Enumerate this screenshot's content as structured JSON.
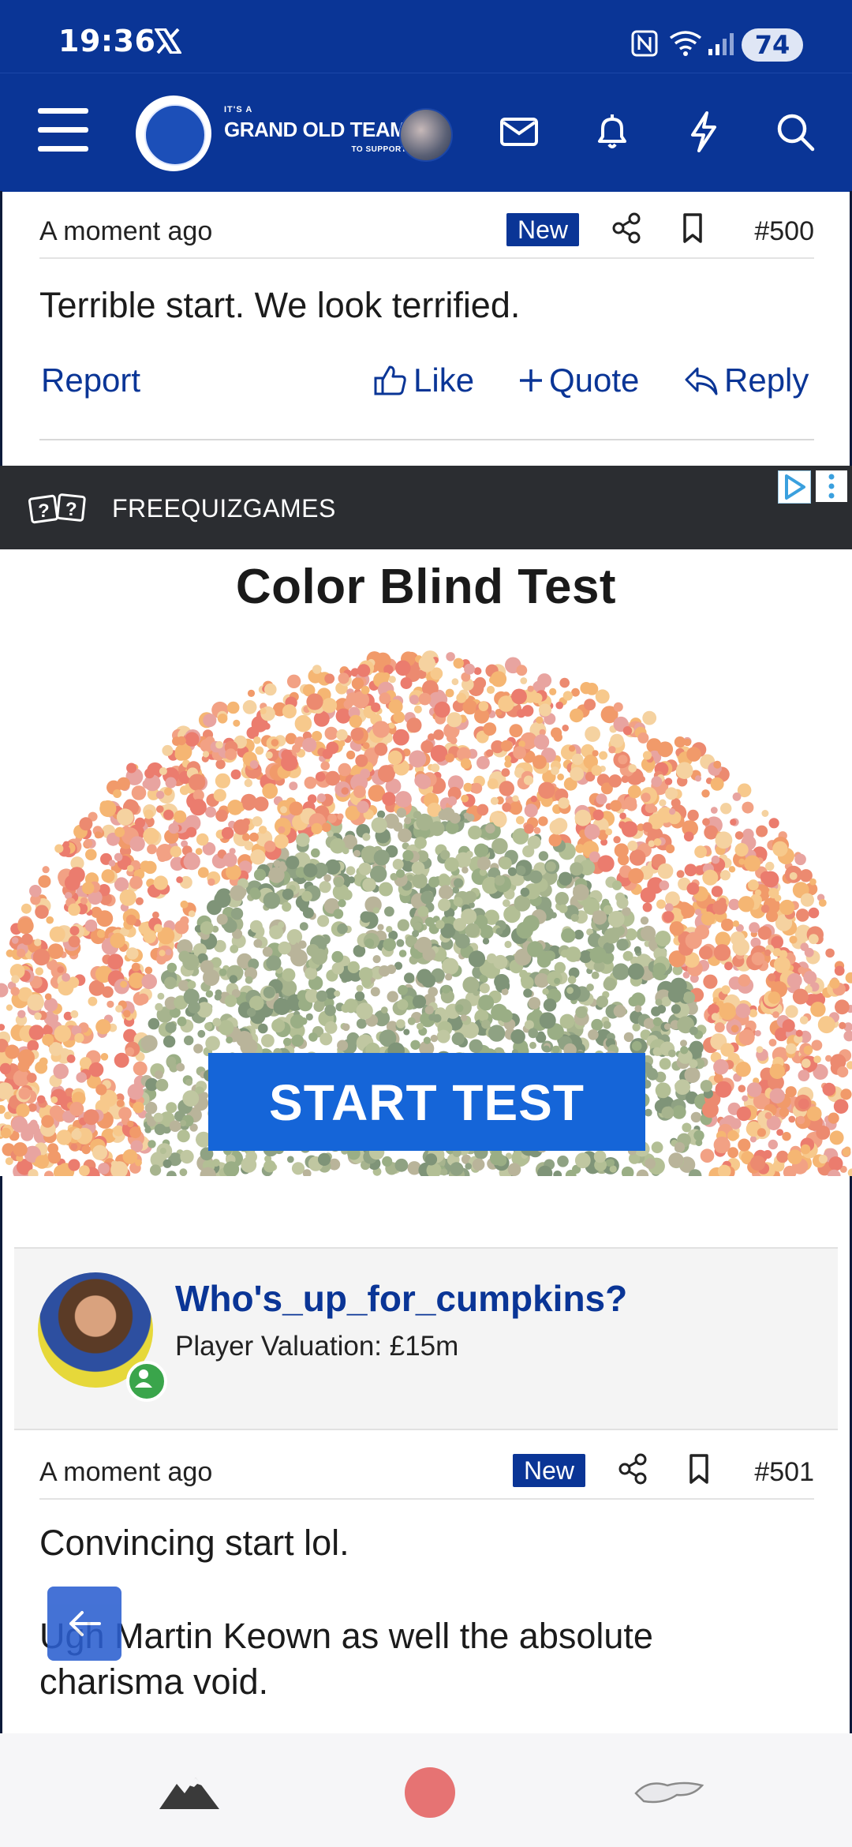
{
  "status_bar": {
    "time": "19:36",
    "battery": "74",
    "icons": [
      "x-app-icon",
      "nfc-icon",
      "wifi-icon",
      "signal-icon",
      "battery-icon"
    ]
  },
  "header": {
    "menu_icon": "hamburger-menu-icon",
    "brand": {
      "small": "IT'S A",
      "title": "GRAND OLD TEAM",
      "sub": "TO SUPPORT"
    },
    "icons": [
      "envelope-icon",
      "bell-icon",
      "lightning-icon",
      "search-icon"
    ],
    "color": "#0a3596"
  },
  "post_500": {
    "time": "A moment ago",
    "badge": "New",
    "number": "#500",
    "text": "Terrible start. We look terrified.",
    "actions": {
      "report": "Report",
      "like": "Like",
      "quote": "Quote",
      "reply": "Reply"
    }
  },
  "ad": {
    "brand": "FREEQUIZGAMES",
    "brand_icon": "[?][?]",
    "title": "Color Blind Test",
    "button": "START TEST",
    "button_color": "#1565d8"
  },
  "post_501": {
    "user": {
      "name": "Who's_up_for_cumpkins?",
      "valuation": "Player Valuation: £15m"
    },
    "time": "A moment ago",
    "badge": "New",
    "number": "#501",
    "paragraphs": [
      "Convincing start lol.",
      "Ugh Martin Keown as well the absolute",
      "charisma void."
    ]
  },
  "floating_back": {
    "icon": "arrow-left-icon"
  },
  "bottom_nav": {
    "icons": [
      "mountain-icon",
      "home-circle-icon",
      "back-gesture-icon"
    ]
  }
}
